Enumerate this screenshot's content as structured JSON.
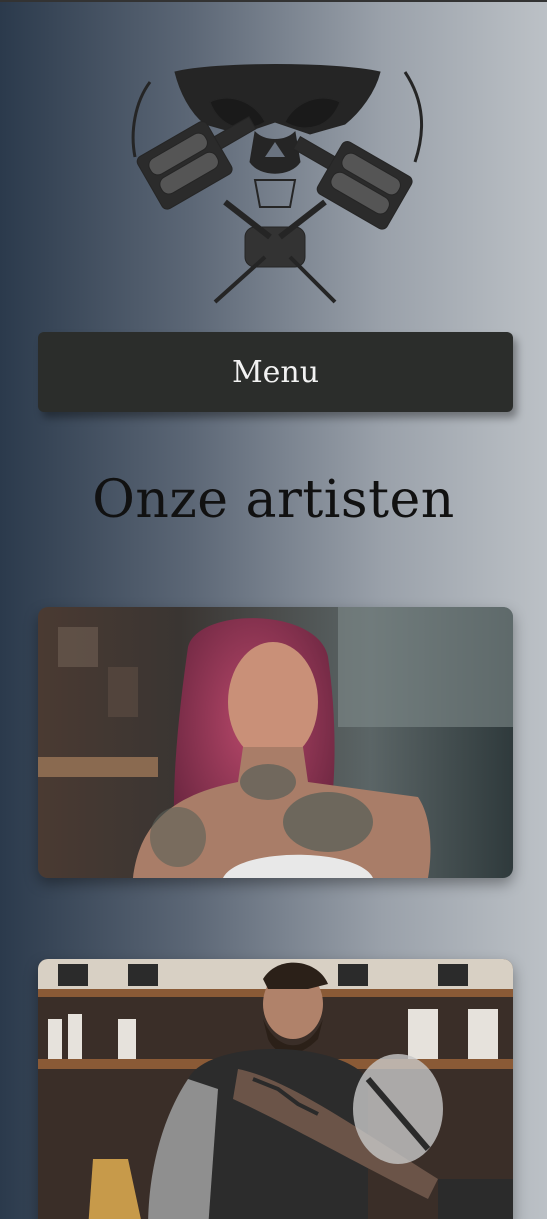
{
  "header": {
    "logo_icon": "skull-tattoo-machines-logo-icon"
  },
  "nav": {
    "menu_label": "Menu"
  },
  "main": {
    "title": "Onze artisten",
    "artists": [
      {
        "photo": "artist-photo-woman-pink-hair"
      },
      {
        "photo": "artist-photo-man-tattooing"
      }
    ]
  },
  "colors": {
    "button_bg": "#2b2d2b",
    "button_text": "#f2f2f2",
    "title_text": "#111111",
    "gradient_dark": "#2b3a4c",
    "gradient_light": "#bcc1c6"
  }
}
